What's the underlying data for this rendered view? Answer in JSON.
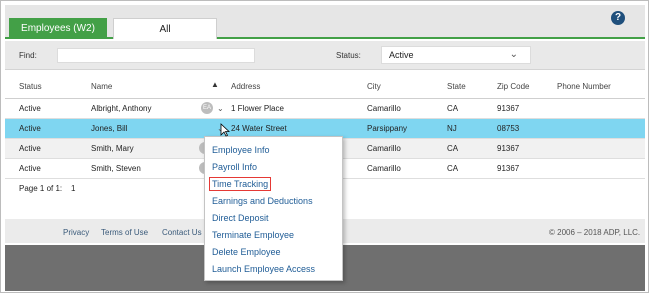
{
  "tabs": [
    {
      "label": "Employees (W2)",
      "active": true
    },
    {
      "label": "All",
      "active": false
    }
  ],
  "help_icon": "?",
  "filters": {
    "find_label": "Find:",
    "find_value": "",
    "status_label": "Status:",
    "status_value": "Active"
  },
  "table": {
    "headers": [
      "Status",
      "Name",
      "Address",
      "City",
      "State",
      "Zip Code",
      "Phone Number"
    ],
    "rows": [
      {
        "status": "Active",
        "name": "Albright, Anthony",
        "badge": "EA",
        "address": "1 Flower Place",
        "city": "Camarillo",
        "state": "CA",
        "zip": "91367",
        "phone": ""
      },
      {
        "status": "Active",
        "name": "Jones, Bill",
        "badge": "",
        "address": "24 Water Street",
        "city": "Parsippany",
        "state": "NJ",
        "zip": "08753",
        "phone": ""
      },
      {
        "status": "Active",
        "name": "Smith, Mary",
        "badge": "",
        "address": "",
        "city": "Camarillo",
        "state": "CA",
        "zip": "91367",
        "phone": ""
      },
      {
        "status": "Active",
        "name": "Smith, Steven",
        "badge": "",
        "address": "",
        "city": "Camarillo",
        "state": "CA",
        "zip": "91367",
        "phone": ""
      }
    ],
    "selected_row": 1
  },
  "pager": {
    "label": "Page 1 of 1:",
    "page": "1"
  },
  "footer": {
    "links": [
      "Privacy",
      "Terms of Use",
      "Contact Us"
    ],
    "copyright": "© 2006 – 2018 ADP, LLC."
  },
  "context_menu": {
    "items": [
      {
        "label": "Employee Info",
        "highlighted": false
      },
      {
        "label": "Payroll Info",
        "highlighted": false
      },
      {
        "label": "Time Tracking",
        "highlighted": true
      },
      {
        "label": "Earnings and Deductions",
        "highlighted": false
      },
      {
        "label": "Direct Deposit",
        "highlighted": false
      },
      {
        "label": "Terminate Employee",
        "highlighted": false
      },
      {
        "label": "Delete Employee",
        "highlighted": false
      },
      {
        "label": "Launch Employee Access",
        "highlighted": false
      }
    ]
  },
  "colors": {
    "accent": "#43a047",
    "selected_row": "#7fd6f1",
    "link": "#1f5c96",
    "highlight_border": "#e53935"
  }
}
